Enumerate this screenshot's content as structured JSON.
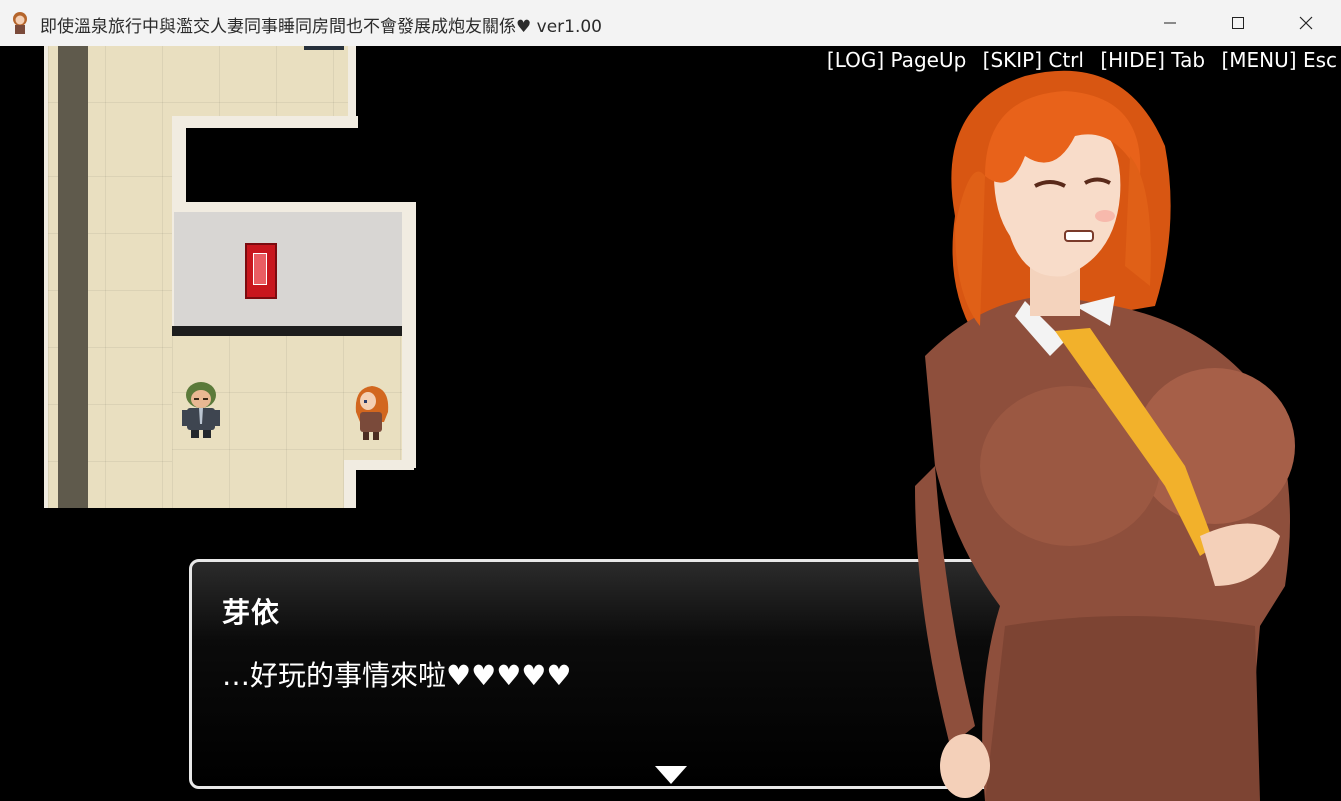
{
  "window": {
    "title": "即使溫泉旅行中與濫交人妻同事睡同房間也不會發展成炮友關係♥ ver1.00",
    "buttons": {
      "minimize": "—",
      "maximize": "☐",
      "close": "✕"
    }
  },
  "hotkeys": {
    "log": "[LOG] PageUp",
    "skip": "[SKIP] Ctrl",
    "hide": "[HIDE] Tab",
    "menu": "[MENU] Esc"
  },
  "dialog": {
    "speaker": "芽依",
    "text": "…好玩的事情來啦♥♥♥♥♥"
  },
  "colors": {
    "hair": "#e8621a",
    "suit": "#8e4f3c",
    "tie": "#f2b12b",
    "floor": "#e9dfc0",
    "extinguisher": "#c8161d"
  }
}
